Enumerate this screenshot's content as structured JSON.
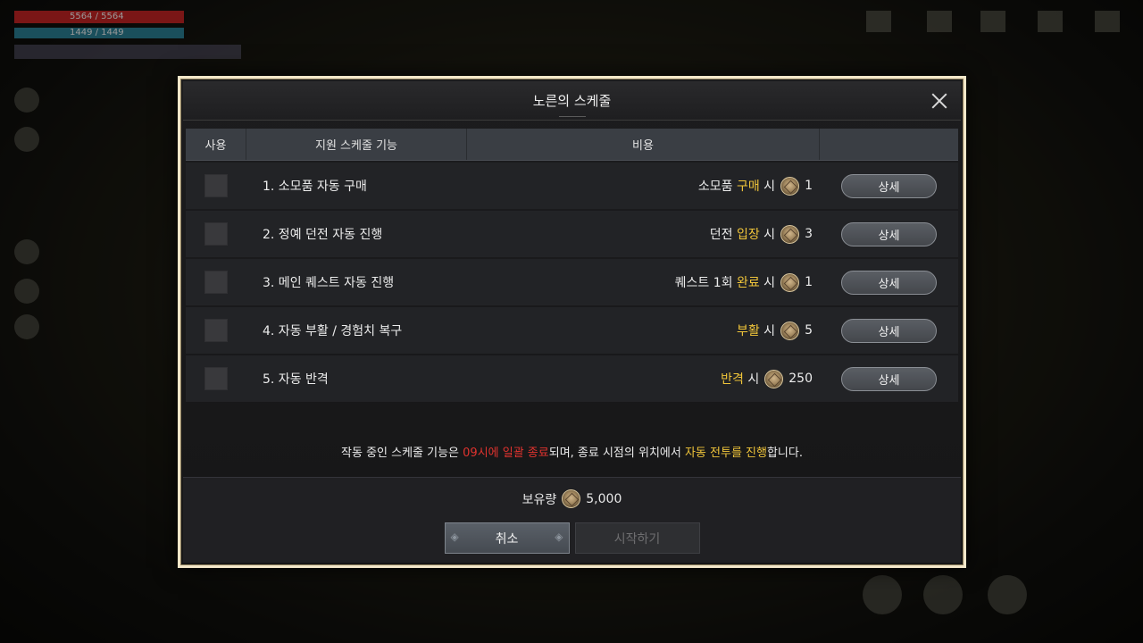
{
  "hud": {
    "hp": "5564 / 5564",
    "mp": "1449 / 1449"
  },
  "modal": {
    "title": "노른의 스케줄",
    "columns": {
      "use": "사용",
      "feature": "지원 스케줄 기능",
      "cost": "비용"
    },
    "rows": [
      {
        "feature": "1. 소모품 자동 구매",
        "cost_pre": "소모품 ",
        "cost_hl": "구매",
        "cost_post": " 시",
        "amount": "1",
        "button": "상세"
      },
      {
        "feature": "2. 정예 던전 자동 진행",
        "cost_pre": "던전 ",
        "cost_hl": "입장",
        "cost_post": " 시",
        "amount": "3",
        "button": "상세"
      },
      {
        "feature": "3. 메인 퀘스트 자동 진행",
        "cost_pre": "퀘스트 1회 ",
        "cost_hl": "완료",
        "cost_post": " 시",
        "amount": "1",
        "button": "상세"
      },
      {
        "feature": "4. 자동 부활 / 경험치 복구",
        "cost_pre": "",
        "cost_hl": "부활",
        "cost_post": " 시",
        "amount": "5",
        "button": "상세"
      },
      {
        "feature": "5. 자동 반격",
        "cost_pre": "",
        "cost_hl": "반격",
        "cost_post": " 시",
        "amount": "250",
        "button": "상세"
      }
    ],
    "notice": {
      "part1": "작동 중인 스케줄 기능은 ",
      "red": "09시에 일괄 종료",
      "part2": "되며, 종료 시점의 위치에서 ",
      "yellow": "자동 전투를 진행",
      "part3": "합니다."
    },
    "holdings_label": "보유량",
    "holdings_amount": "5,000",
    "cancel_label": "취소",
    "start_label": "시작하기"
  },
  "colors": {
    "highlight": "#f0c53a",
    "warning": "#e0332e",
    "frame": "#f3e7c9"
  }
}
